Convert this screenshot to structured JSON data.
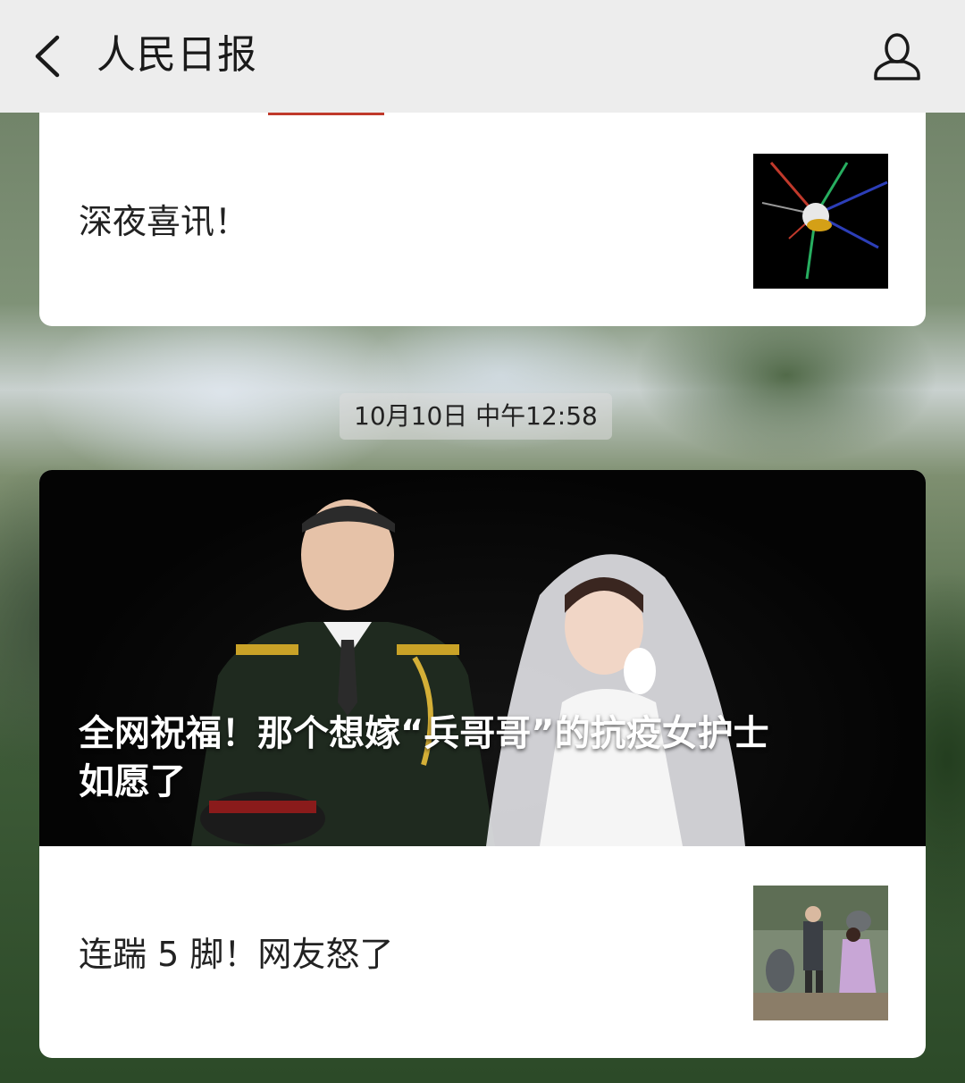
{
  "header": {
    "title": "人民日报",
    "back_icon": "chevron-left-icon",
    "profile_icon": "user-profile-icon"
  },
  "articles_top": [
    {
      "title": "深夜喜讯！",
      "thumbnail": "satellite-image"
    }
  ],
  "timestamp": "10月10日 中午12:58",
  "featured": {
    "title_line1": "全网祝福！那个想嫁“兵哥哥”的抗疫女护士",
    "title_line2": "如愿了",
    "image": "wedding-photo"
  },
  "articles_bottom": [
    {
      "title": "连踹 5 脚！网友怒了",
      "thumbnail": "street-photo"
    }
  ],
  "colors": {
    "header_bg": "#ededed",
    "card_bg": "#ffffff",
    "hero_bg": "#0a0a0a"
  }
}
